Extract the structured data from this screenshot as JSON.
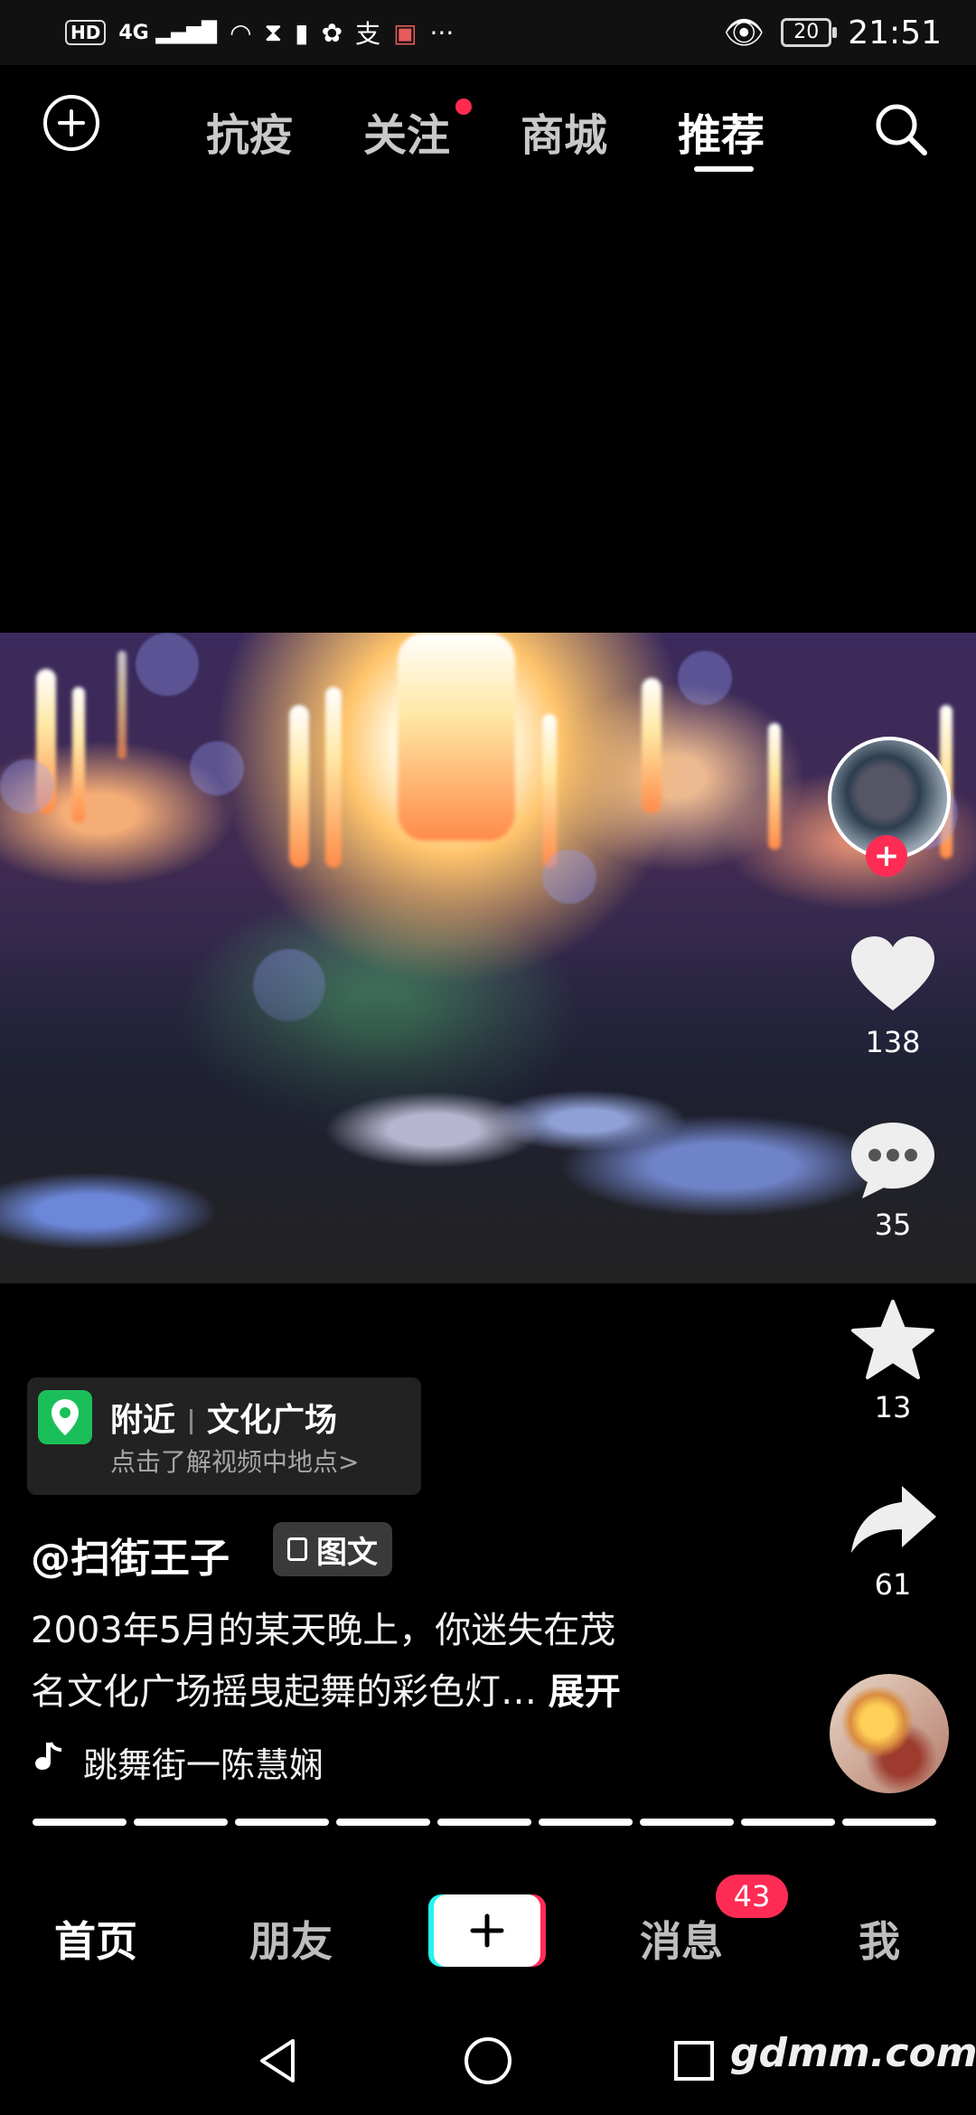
{
  "status_bar": {
    "left_icons": [
      "hd-icon",
      "signal-4g-icon",
      "wifi-icon",
      "hourglass-icon",
      "battery-warning-icon",
      "app-icon",
      "alipay-icon",
      "gift-icon",
      "more-icon"
    ],
    "hd": "HD",
    "signal": "4G",
    "battery_level": "20",
    "time": "21:51"
  },
  "top_nav": {
    "tabs": [
      {
        "label": "抗疫"
      },
      {
        "label": "关注"
      },
      {
        "label": "商城"
      },
      {
        "label": "推荐"
      }
    ],
    "active_tab": "推荐"
  },
  "right_rail": {
    "likes": "138",
    "comments": "35",
    "favorites": "13",
    "shares": "61"
  },
  "location": {
    "nearby": "附近",
    "place": "文化广场",
    "hint": "点击了解视频中地点>"
  },
  "post": {
    "author": "@扫街王子",
    "type_badge": "图文",
    "caption_line1": "2003年5月的某天晚上，你迷失在茂",
    "caption_line2": "名文化广场摇曳起舞的彩色灯…",
    "expand_label": "展开",
    "music": "跳舞街一陈慧娴"
  },
  "progress": {
    "segments": 9
  },
  "bottom_nav": {
    "home": "首页",
    "friends": "朋友",
    "messages": "消息",
    "messages_badge": "43",
    "me": "我"
  },
  "watermark": "gdmm.com",
  "colors": {
    "accent": "#fe2c55",
    "location_pin": "#1bbf5a",
    "cyan": "#25f4ee"
  }
}
